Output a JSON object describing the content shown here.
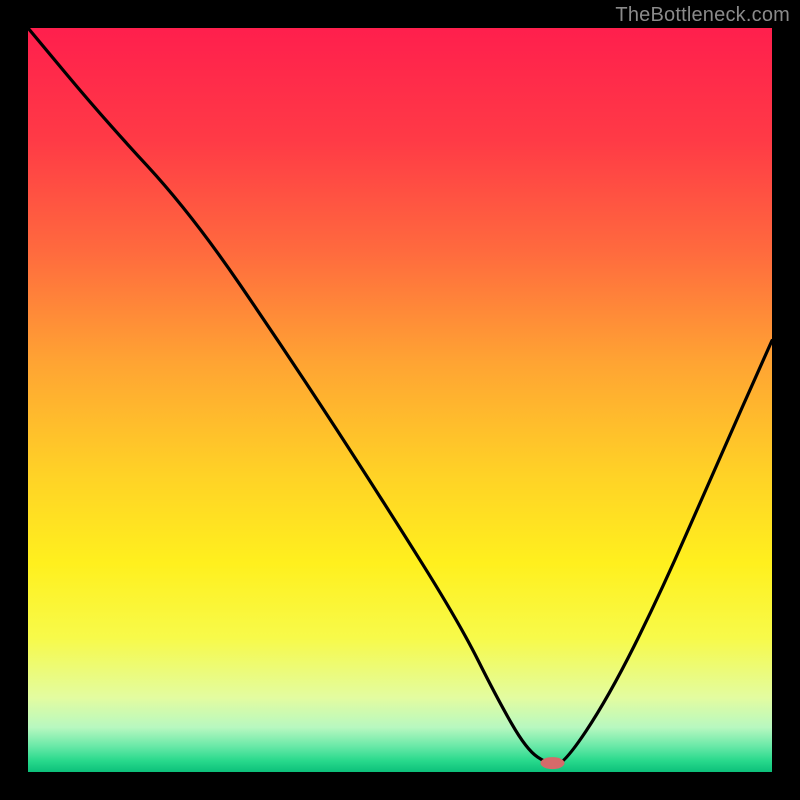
{
  "watermark": "TheBottleneck.com",
  "chart_data": {
    "type": "line",
    "title": "",
    "xlabel": "",
    "ylabel": "",
    "xlim": [
      0,
      100
    ],
    "ylim": [
      0,
      100
    ],
    "grid": false,
    "legend": false,
    "background_gradient_stops": [
      {
        "offset": 0.0,
        "color": "#ff1f4d"
      },
      {
        "offset": 0.15,
        "color": "#ff3a46"
      },
      {
        "offset": 0.3,
        "color": "#ff6a3e"
      },
      {
        "offset": 0.45,
        "color": "#ffa433"
      },
      {
        "offset": 0.6,
        "color": "#ffd226"
      },
      {
        "offset": 0.72,
        "color": "#fff01e"
      },
      {
        "offset": 0.82,
        "color": "#f7fa4a"
      },
      {
        "offset": 0.9,
        "color": "#e3fca0"
      },
      {
        "offset": 0.94,
        "color": "#b8f8c0"
      },
      {
        "offset": 0.965,
        "color": "#6ae9a8"
      },
      {
        "offset": 0.985,
        "color": "#28d98c"
      },
      {
        "offset": 1.0,
        "color": "#0cc07a"
      }
    ],
    "series": [
      {
        "name": "bottleneck-curve",
        "x": [
          0,
          10,
          22,
          35,
          48,
          58,
          63,
          67,
          70,
          72,
          78,
          85,
          92,
          100
        ],
        "y": [
          100,
          88,
          75,
          56,
          36,
          20,
          10,
          3,
          1,
          1,
          10,
          24,
          40,
          58
        ]
      }
    ],
    "marker": {
      "name": "optimum-marker",
      "x": 70.5,
      "y": 1.2,
      "color": "#d66a6a",
      "rx": 12,
      "ry": 6
    }
  }
}
